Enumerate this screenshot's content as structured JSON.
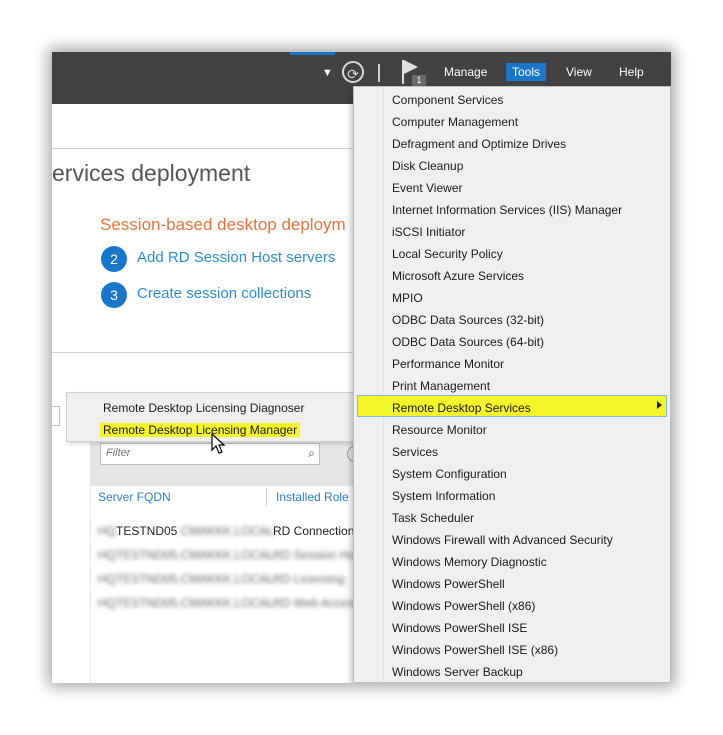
{
  "toolbar": {
    "menus": [
      "Manage",
      "Tools",
      "View",
      "Help"
    ],
    "active_menu": "Tools",
    "notification_count": "1",
    "refresh_icon": "refresh-icon",
    "flag_icon": "notifications-flag-icon"
  },
  "main": {
    "heading": "ervices deployment",
    "subheading": "Session-based desktop deploym",
    "steps": [
      {
        "number": "2",
        "label": "Add RD Session Host servers"
      },
      {
        "number": "3",
        "label": "Create session collections"
      }
    ]
  },
  "context_menu": {
    "items": [
      "Remote Desktop Licensing Diagnoser",
      "Remote Desktop Licensing Manager"
    ],
    "highlighted": "Remote Desktop Licensing Manager"
  },
  "servers": {
    "filter_placeholder": "Filter",
    "columns": [
      "Server FQDN",
      "Installed Role S"
    ],
    "rows": [
      {
        "fqdn": "HQTESTND05.CMAKKK.LOCAL",
        "role": "RD Connection"
      },
      {
        "fqdn": "HQTESTND05.CMAKKK.LOCAL",
        "role": "RD Session Hos"
      },
      {
        "fqdn": "HQTESTND05.CMAKKK.LOCAL",
        "role": "RD Licensing"
      },
      {
        "fqdn": "HQTESTND05.CMAKKK.LOCAL",
        "role": "RD Web Access"
      }
    ]
  },
  "tools_menu": {
    "items": [
      "Component Services",
      "Computer Management",
      "Defragment and Optimize Drives",
      "Disk Cleanup",
      "Event Viewer",
      "Internet Information Services (IIS) Manager",
      "iSCSI Initiator",
      "Local Security Policy",
      "Microsoft Azure Services",
      "MPIO",
      "ODBC Data Sources (32-bit)",
      "ODBC Data Sources (64-bit)",
      "Performance Monitor",
      "Print Management",
      "Remote Desktop Services",
      "Resource Monitor",
      "Services",
      "System Configuration",
      "System Information",
      "Task Scheduler",
      "Windows Firewall with Advanced Security",
      "Windows Memory Diagnostic",
      "Windows PowerShell",
      "Windows PowerShell (x86)",
      "Windows PowerShell ISE",
      "Windows PowerShell ISE (x86)",
      "Windows Server Backup"
    ],
    "highlighted": "Remote Desktop Services"
  },
  "colors": {
    "titlebar": "#424242",
    "accent_blue": "#1a76c8",
    "orange": "#e8743b",
    "link_blue": "#2b8fcf",
    "highlight_yellow": "#f5f52a"
  }
}
